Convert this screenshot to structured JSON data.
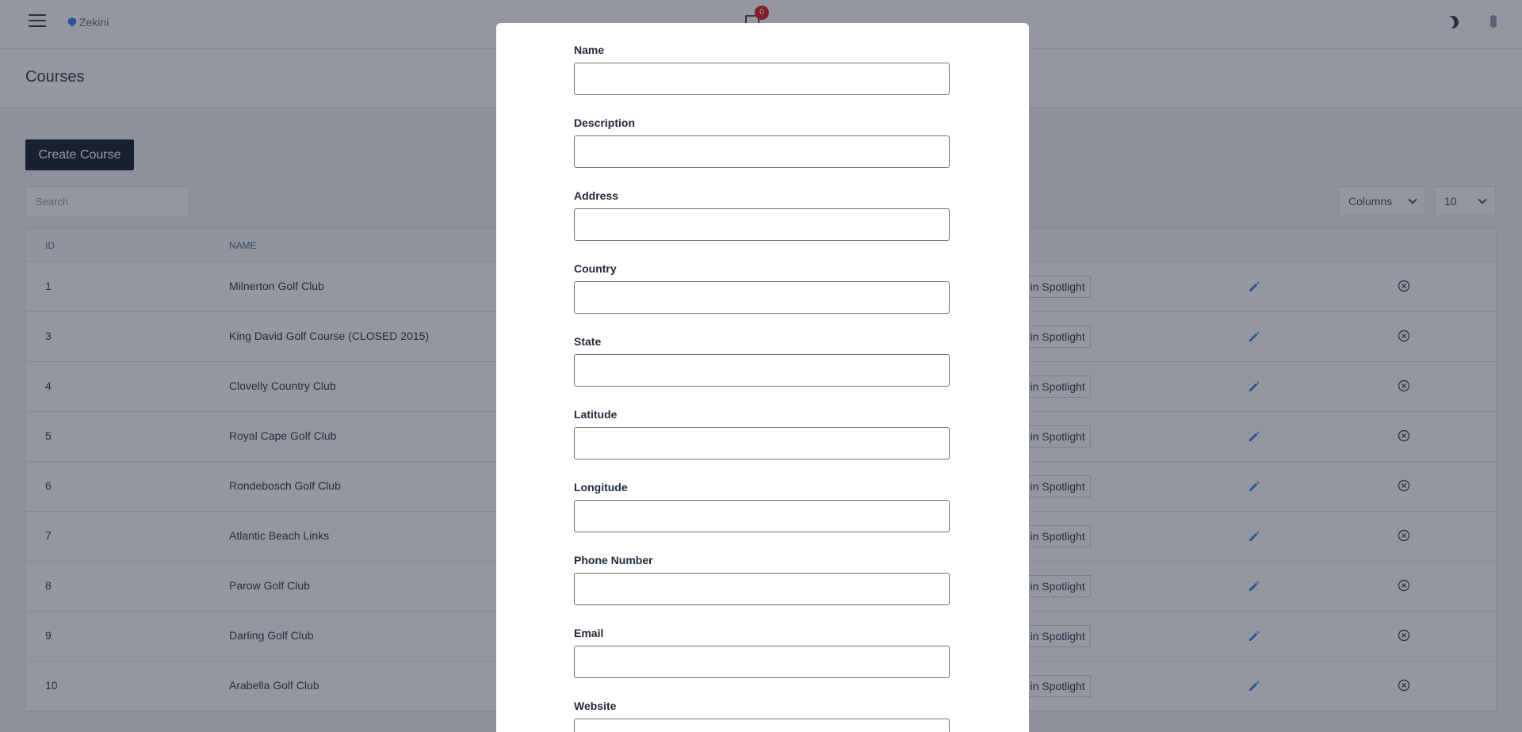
{
  "brand": {
    "name": "Zekini"
  },
  "notifications": {
    "count": "0"
  },
  "page": {
    "title": "Courses"
  },
  "toolbar": {
    "create_label": "Create Course",
    "search_placeholder": "Search",
    "columns_label": "Columns",
    "page_size": "10"
  },
  "table": {
    "headers": {
      "id": "ID",
      "name": "NAME"
    },
    "spotlight_label": "ge in Spotlight",
    "rows": [
      {
        "id": "1",
        "name": "Milnerton Golf Club"
      },
      {
        "id": "3",
        "name": "King David Golf Course (CLOSED 2015)"
      },
      {
        "id": "4",
        "name": "Clovelly Country Club"
      },
      {
        "id": "5",
        "name": "Royal Cape Golf Club"
      },
      {
        "id": "6",
        "name": "Rondebosch Golf Club"
      },
      {
        "id": "7",
        "name": "Atlantic Beach Links"
      },
      {
        "id": "8",
        "name": "Parow Golf Club"
      },
      {
        "id": "9",
        "name": "Darling Golf Club"
      },
      {
        "id": "10",
        "name": "Arabella Golf Club"
      }
    ]
  },
  "modal": {
    "fields": [
      {
        "label": "Name",
        "value": ""
      },
      {
        "label": "Description",
        "value": ""
      },
      {
        "label": "Address",
        "value": ""
      },
      {
        "label": "Country",
        "value": ""
      },
      {
        "label": "State",
        "value": ""
      },
      {
        "label": "Latitude",
        "value": ""
      },
      {
        "label": "Longitude",
        "value": ""
      },
      {
        "label": "Phone Number",
        "value": ""
      },
      {
        "label": "Email",
        "value": ""
      },
      {
        "label": "Website",
        "value": ""
      }
    ]
  },
  "icons": {
    "menu": "hamburger-icon",
    "notification": "chat-icon",
    "theme": "moon-icon",
    "edit": "pencil-icon",
    "delete": "x-circle-icon"
  },
  "colors": {
    "primary_button": "#1f2937",
    "edit_icon": "#3b82f6",
    "badge": "#dc2626"
  }
}
